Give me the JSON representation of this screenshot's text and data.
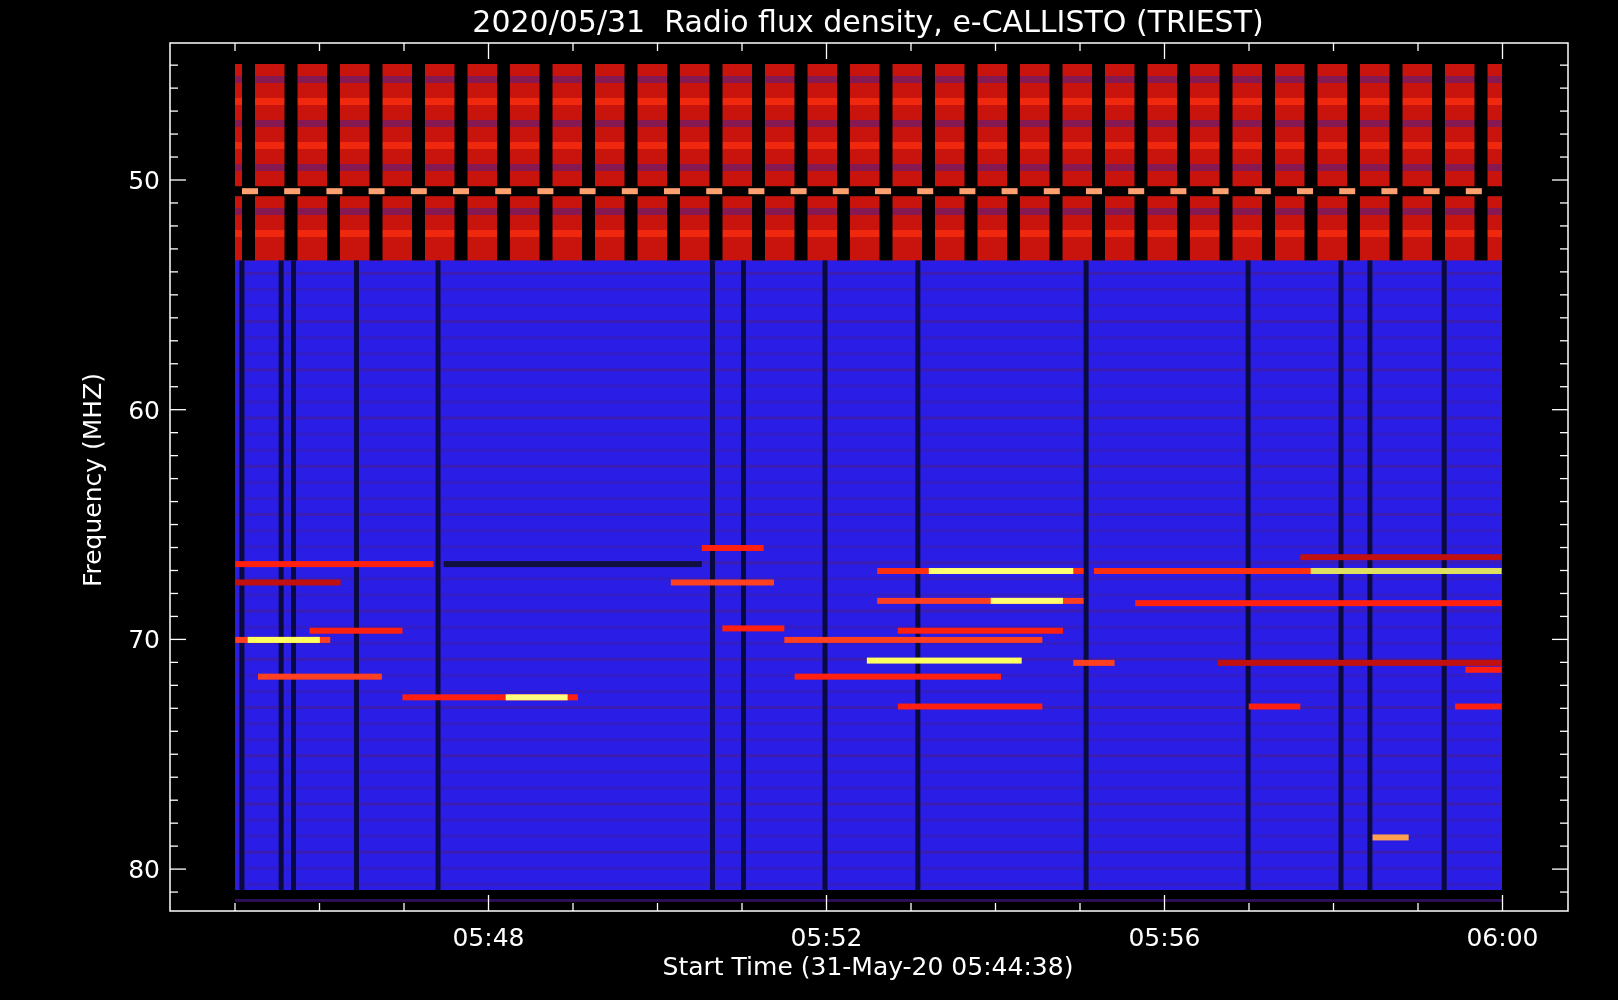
{
  "plot": {
    "title": "2020/05/31  Radio flux density, e-CALLISTO (TRIEST)",
    "y_axis": {
      "label": "Frequency (MHZ)",
      "ticks": [
        "50",
        "60",
        "70",
        "80"
      ]
    },
    "x_axis": {
      "label": "Start Time (31-May-20 05:44:38)",
      "ticks": [
        "05:48",
        "05:52",
        "05:56",
        "06:00"
      ]
    }
  }
}
